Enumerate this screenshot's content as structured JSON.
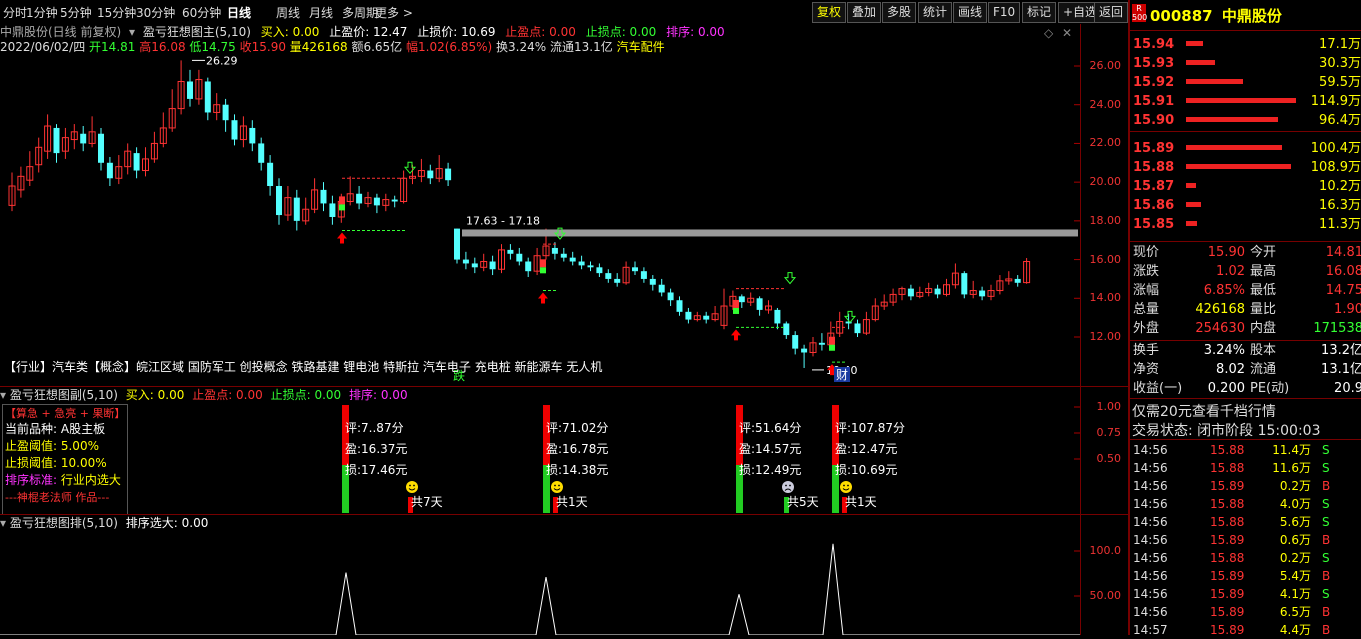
{
  "toolbar": {
    "periods": [
      "分时",
      "1分钟",
      "5分钟",
      "15分钟",
      "30分钟",
      "60分钟",
      "日线",
      "周线",
      "月线",
      "多周期",
      "更多 >"
    ],
    "active_period": "日线",
    "buttons": [
      "复权",
      "叠加",
      "多股",
      "统计",
      "画线",
      "F10",
      "标记",
      "+自选",
      "返回"
    ]
  },
  "main": {
    "indicator_title": "盈亏狂想图主(5,10)",
    "buy_label": "买入: 0.00",
    "tp_label": "止盈价: 12.47",
    "sl_label": "止损价: 10.69",
    "tp2_label": "止盈点: 0.00",
    "sl2_label": "止损点: 0.00",
    "rank_label": "排序: 0.00",
    "stock_title": "中鼎股份(日线 前复权)",
    "date": "2022/06/02/四",
    "open": "开14.81",
    "high": "高16.08",
    "low": "低14.75",
    "close": "收15.90",
    "volume": "量426168",
    "amount": "额6.65亿",
    "change": "幅1.02(6.85%)",
    "turnover": "换3.24%",
    "float": "流通13.1亿",
    "sector": "汽车配件",
    "y_ticks": [
      "26.00",
      "24.00",
      "22.00",
      "20.00",
      "18.00",
      "16.00",
      "14.00",
      "12.00"
    ],
    "peak_label": "26.29",
    "trough_label": "10.40",
    "band_label": "17.63 - 17.18",
    "fall_label": "跌",
    "cai_label": "财",
    "concepts": "【行业】汽车类【概念】皖江区域 国防军工 创投概念 铁路基建 锂电池 特斯拉 汽车电子 充电桩 新能源车 无人机"
  },
  "sub1": {
    "title": "盈亏狂想图副(5,10)",
    "buy": "买入: 0.00",
    "tp": "止盈点: 0.00",
    "sl": "止损点: 0.00",
    "rank": "排序: 0.00",
    "y_ticks": [
      "1.00",
      "0.75",
      "0.50"
    ],
    "info_head": "【算急 + 急亮 + 果断】",
    "info_lines": [
      {
        "k": "当前品种:",
        "v": "A股主板"
      },
      {
        "k": "止盈阈值:",
        "v": "5.00%"
      },
      {
        "k": "止损阈值:",
        "v": "10.00%"
      },
      {
        "k": "排序标准:",
        "v": "行业内选大"
      }
    ],
    "info_foot": "---神棍老法师 作品---",
    "signals": [
      {
        "score": "评:7..87分",
        "tp": "盈:16.37元",
        "sl": "损:17.46元",
        "days": "共7天",
        "face": "smile"
      },
      {
        "score": "评:71.02分",
        "tp": "盈:16.78元",
        "sl": "损:14.38元",
        "days": "共1天",
        "face": "smile"
      },
      {
        "score": "评:51.64分",
        "tp": "盈:14.57元",
        "sl": "损:12.49元",
        "days": "共5天",
        "face": "sad"
      },
      {
        "score": "评:107.87分",
        "tp": "盈:12.47元",
        "sl": "损:10.69元",
        "days": "共1天",
        "face": "smile"
      }
    ]
  },
  "sub2": {
    "title": "盈亏狂想图排(5,10)",
    "rank": "排序选大: 0.00",
    "y_ticks": [
      "100.0",
      "50.00"
    ]
  },
  "right": {
    "badge": "R 500",
    "code": "000887",
    "name": "中鼎股份",
    "asks": [
      {
        "p": "15.94",
        "v": "17.1万",
        "w": 0.15
      },
      {
        "p": "15.93",
        "v": "30.3万",
        "w": 0.26
      },
      {
        "p": "15.92",
        "v": "59.5万",
        "w": 0.52
      },
      {
        "p": "15.91",
        "v": "114.9万",
        "w": 1.0
      },
      {
        "p": "15.90",
        "v": "96.4万",
        "w": 0.84
      }
    ],
    "bids": [
      {
        "p": "15.89",
        "v": "100.4万",
        "w": 0.87
      },
      {
        "p": "15.88",
        "v": "108.9万",
        "w": 0.95
      },
      {
        "p": "15.87",
        "v": "10.2万",
        "w": 0.09
      },
      {
        "p": "15.86",
        "v": "16.3万",
        "w": 0.14
      },
      {
        "p": "15.85",
        "v": "11.3万",
        "w": 0.1
      }
    ],
    "quote": [
      {
        "k1": "现价",
        "v1": "15.90",
        "k2": "今开",
        "v2": "14.81",
        "c1": "#f33",
        "c2": "#f33"
      },
      {
        "k1": "涨跌",
        "v1": "1.02",
        "k2": "最高",
        "v2": "16.08",
        "c1": "#f33",
        "c2": "#f33"
      },
      {
        "k1": "涨幅",
        "v1": "6.85%",
        "k2": "最低",
        "v2": "14.75",
        "c1": "#f33",
        "c2": "#f33"
      },
      {
        "k1": "总量",
        "v1": "426168",
        "k2": "量比",
        "v2": "1.90",
        "c1": "#ff0",
        "c2": "#f33"
      },
      {
        "k1": "外盘",
        "v1": "254630",
        "k2": "内盘",
        "v2": "171538",
        "c1": "#f33",
        "c2": "#3f3"
      }
    ],
    "fin": [
      {
        "k1": "换手",
        "v1": "3.24%",
        "k2": "股本",
        "v2": "13.2亿"
      },
      {
        "k1": "净资",
        "v1": "8.02",
        "k2": "流通",
        "v2": "13.1亿"
      },
      {
        "k1": "收益(一)",
        "v1": "0.200",
        "k2": "PE(动)",
        "v2": "20.9"
      }
    ],
    "promo": "仅需20元查看千档行情",
    "status": "交易状态: 闭市阶段 15:00:03",
    "ticks": [
      {
        "t": "14:56",
        "p": "15.88",
        "v": "11.4万",
        "s": "S"
      },
      {
        "t": "14:56",
        "p": "15.88",
        "v": "11.6万",
        "s": "S"
      },
      {
        "t": "14:56",
        "p": "15.89",
        "v": "0.2万",
        "s": "B"
      },
      {
        "t": "14:56",
        "p": "15.88",
        "v": "4.0万",
        "s": "S"
      },
      {
        "t": "14:56",
        "p": "15.88",
        "v": "5.6万",
        "s": "S"
      },
      {
        "t": "14:56",
        "p": "15.89",
        "v": "0.6万",
        "s": "B"
      },
      {
        "t": "14:56",
        "p": "15.88",
        "v": "0.2万",
        "s": "S"
      },
      {
        "t": "14:56",
        "p": "15.89",
        "v": "5.4万",
        "s": "B"
      },
      {
        "t": "14:56",
        "p": "15.89",
        "v": "4.1万",
        "s": "S"
      },
      {
        "t": "14:56",
        "p": "15.89",
        "v": "6.5万",
        "s": "B"
      },
      {
        "t": "14:57",
        "p": "15.89",
        "v": "4.4万",
        "s": "B"
      }
    ]
  },
  "colors": {
    "up": "#ff3333",
    "down": "#54ffff",
    "axis": "#770000",
    "grid": "#550000"
  }
}
